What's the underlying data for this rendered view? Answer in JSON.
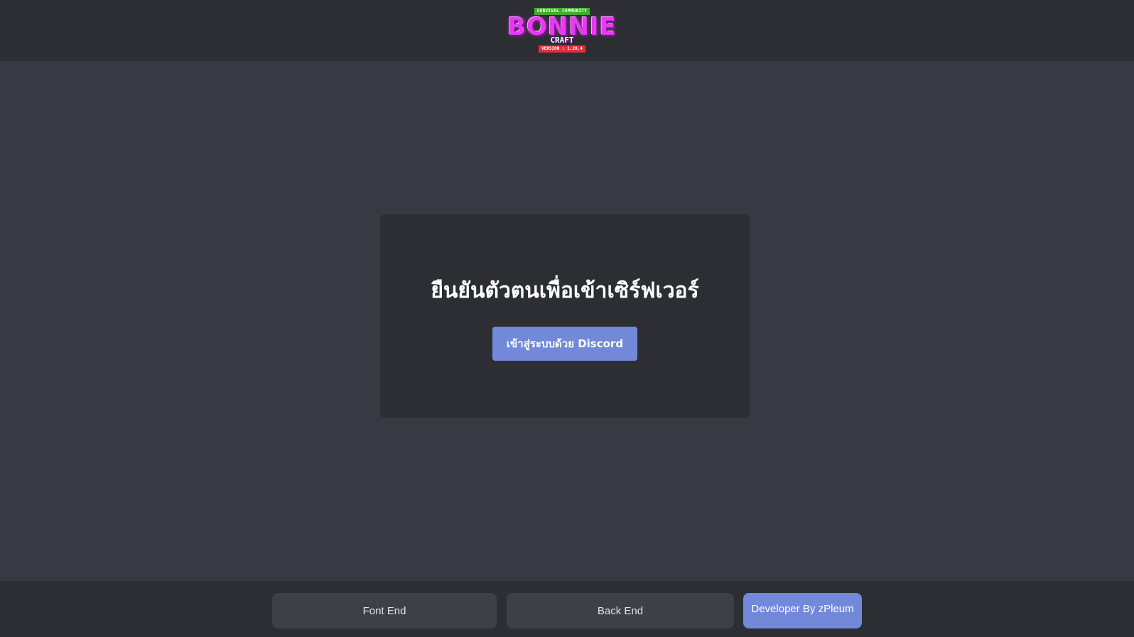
{
  "header": {
    "logo": {
      "tagline": "SURVIVAL COMMUNITY",
      "name": "BONNIE",
      "sub": "CRAFT",
      "version": "VERSION : 1.20.4"
    }
  },
  "main": {
    "title": "ยืนยันตัวตนเพื่อเข้าเซิร์ฟเวอร์",
    "login_button": "เข้าสู่ระบบด้วย Discord"
  },
  "footer": {
    "front_end_label": "Font End",
    "back_end_label": "Back End",
    "developer_label": "Developer By zPleum"
  },
  "colors": {
    "background": "#373a43",
    "panel": "#2d2e33",
    "accent": "#7289da",
    "footer_button": "#3d4047"
  }
}
